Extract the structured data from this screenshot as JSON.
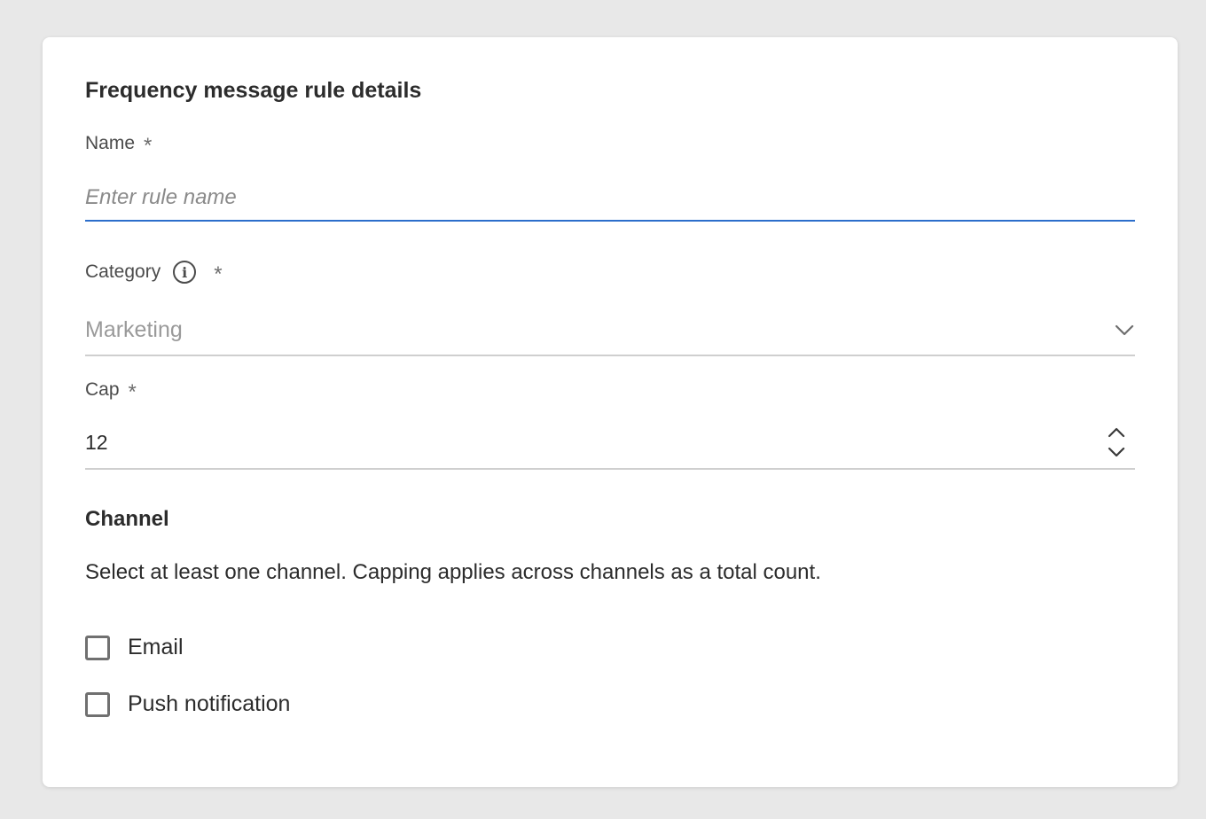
{
  "form": {
    "heading": "Frequency message rule details",
    "name": {
      "label": "Name",
      "required_mark": "*",
      "placeholder": "Enter rule name",
      "value": ""
    },
    "category": {
      "label": "Category",
      "required_mark": "*",
      "info_icon": "info-icon",
      "selected_value": "Marketing"
    },
    "cap": {
      "label": "Cap",
      "required_mark": "*",
      "value": "12"
    }
  },
  "channel": {
    "title": "Channel",
    "help_text": "Select at least one channel. Capping applies across channels as a total count.",
    "options": [
      {
        "label": "Email",
        "checked": false
      },
      {
        "label": "Push notification",
        "checked": false
      }
    ]
  },
  "colors": {
    "focus_underline": "#2c6ecb",
    "background": "#e8e8e8",
    "card": "#ffffff"
  }
}
